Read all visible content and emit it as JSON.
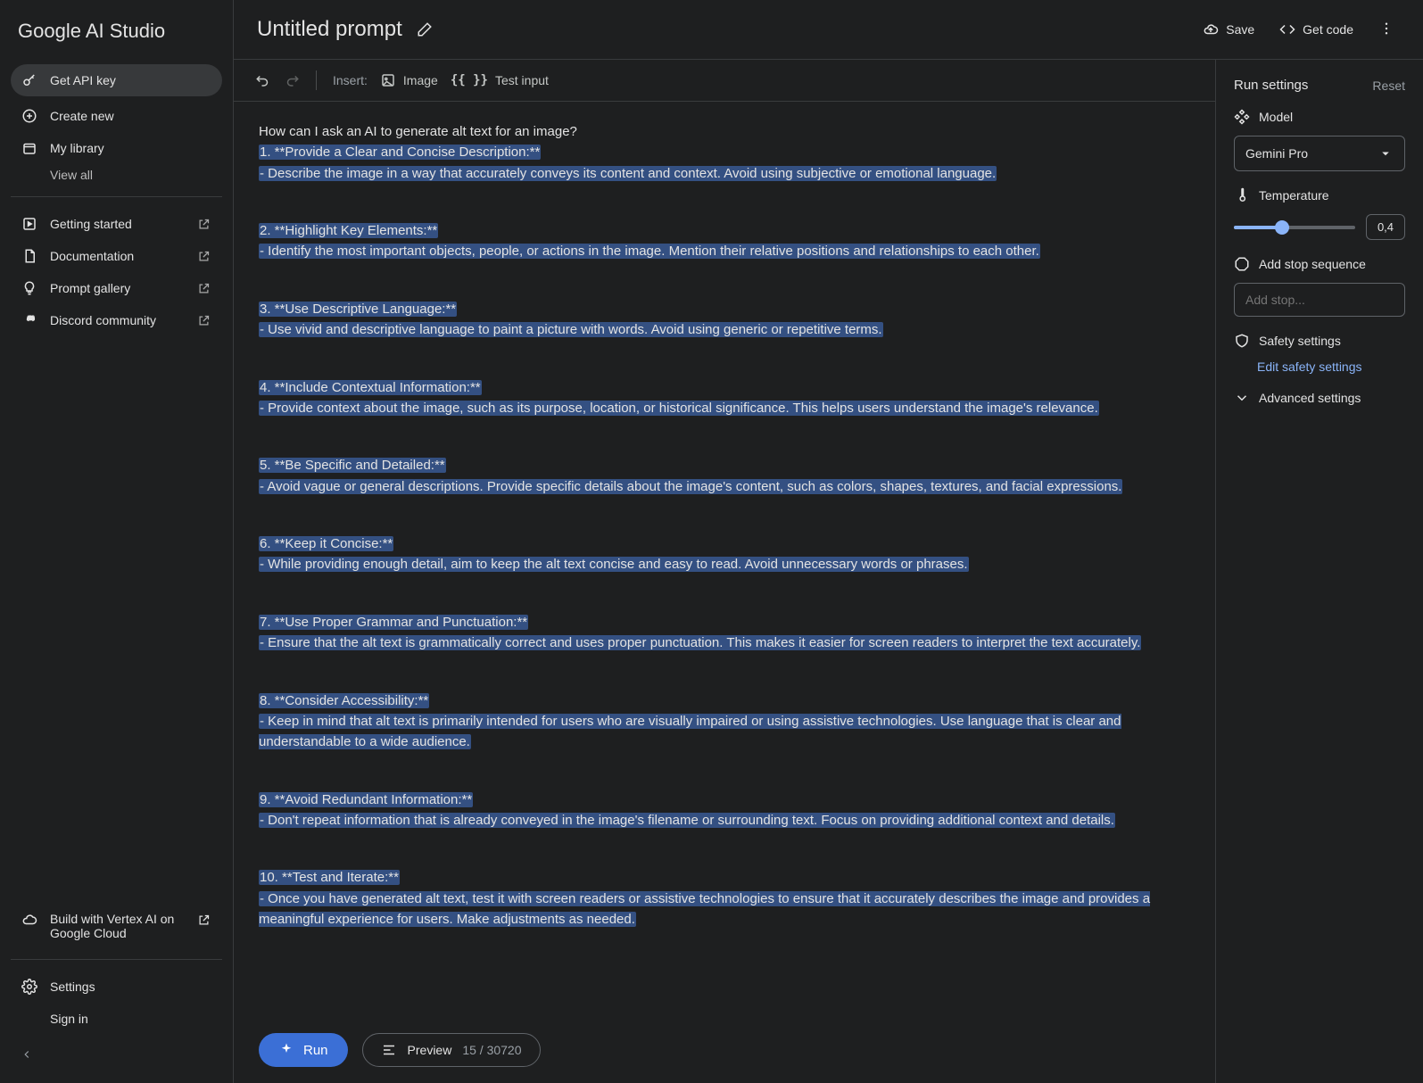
{
  "brand": "Google AI Studio",
  "sidebar": {
    "api_key": "Get API key",
    "create": "Create new",
    "library": "My library",
    "view_all": "View all",
    "getting_started": "Getting started",
    "documentation": "Documentation",
    "prompt_gallery": "Prompt gallery",
    "discord": "Discord community",
    "vertex": "Build with Vertex AI on Google Cloud",
    "settings": "Settings",
    "signin": "Sign in"
  },
  "header": {
    "title": "Untitled prompt",
    "save": "Save",
    "get_code": "Get code"
  },
  "toolbar": {
    "insert": "Insert:",
    "image": "Image",
    "test_input": "Test input"
  },
  "prompt": {
    "q": "How can I ask an AI to generate alt text for an image?",
    "lines": [
      "1. **Provide a Clear and Concise Description:**",
      "   - Describe the image in a way that accurately conveys its content and context. Avoid using subjective or emotional language.",
      "",
      "2. **Highlight Key Elements:**",
      "   - Identify the most important objects, people, or actions in the image. Mention their relative positions and relationships to each other.",
      "",
      "3. **Use Descriptive Language:**",
      "   - Use vivid and descriptive language to paint a picture with words. Avoid using generic or repetitive terms.",
      "",
      "4. **Include Contextual Information:**",
      "   - Provide context about the image, such as its purpose, location, or historical significance. This helps users understand the image's relevance.",
      "",
      "5. **Be Specific and Detailed:**",
      "   - Avoid vague or general descriptions. Provide specific details about the image's content, such as colors, shapes, textures, and facial expressions.",
      "",
      "6. **Keep it Concise:**",
      "   - While providing enough detail, aim to keep the alt text concise and easy to read. Avoid unnecessary words or phrases.",
      "",
      "7. **Use Proper Grammar and Punctuation:**",
      "   - Ensure that the alt text is grammatically correct and uses proper punctuation. This makes it easier for screen readers to interpret the text accurately.",
      "",
      "8. **Consider Accessibility:**",
      "   - Keep in mind that alt text is primarily intended for users who are visually impaired or using assistive technologies. Use language that is clear and understandable to a wide audience.",
      "",
      "9. **Avoid Redundant Information:**",
      "   - Don't repeat information that is already conveyed in the image's filename or surrounding text. Focus on providing additional context and details.",
      "",
      "10. **Test and Iterate:**",
      "    - Once you have generated alt text, test it with screen readers or assistive technologies to ensure that it accurately describes the image and provides a meaningful experience for users. Make adjustments as needed."
    ]
  },
  "footer": {
    "run": "Run",
    "preview": "Preview",
    "tokens": "15 / 30720"
  },
  "settings": {
    "title": "Run settings",
    "reset": "Reset",
    "model_label": "Model",
    "model_value": "Gemini Pro",
    "temperature_label": "Temperature",
    "temperature_value": "0,4",
    "temperature_pct": 40,
    "stop_label": "Add stop sequence",
    "stop_placeholder": "Add stop...",
    "safety_label": "Safety settings",
    "safety_link": "Edit safety settings",
    "advanced": "Advanced settings"
  }
}
